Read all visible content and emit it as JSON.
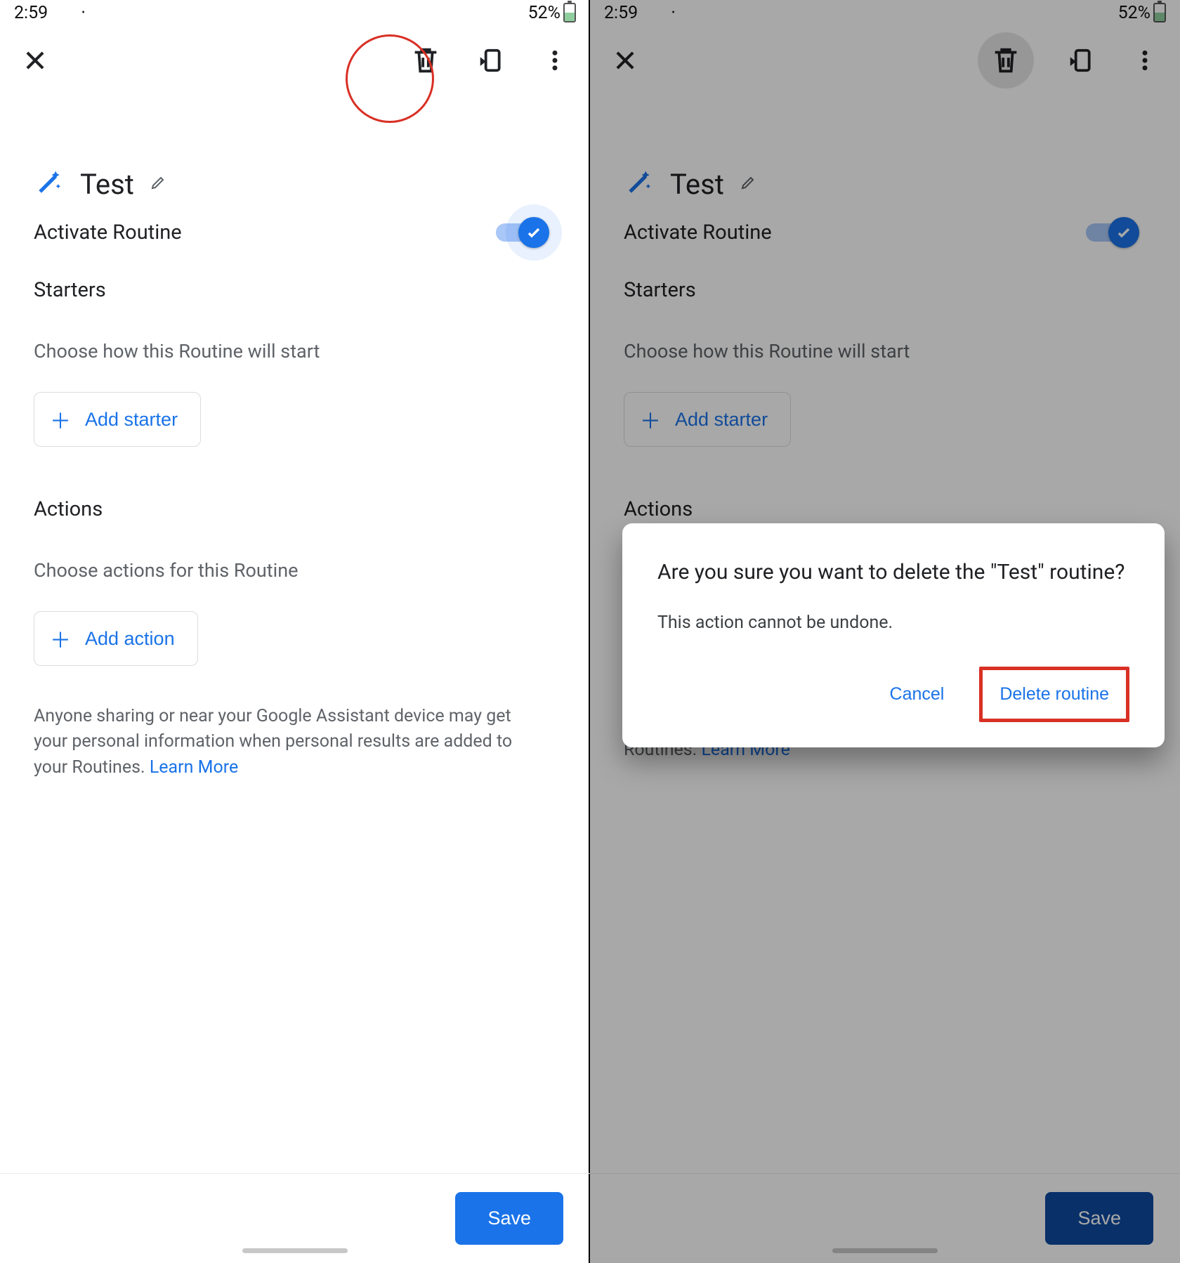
{
  "status": {
    "time": "2:59",
    "batt_pct": "52%"
  },
  "toolbar": {},
  "routine": {
    "name": "Test",
    "activate_label": "Activate Routine",
    "starters_heading": "Starters",
    "starters_sub": "Choose how this Routine will start",
    "add_starter_label": "Add starter",
    "actions_heading": "Actions",
    "actions_sub": "Choose actions for this Routine",
    "add_action_label": "Add action",
    "disclaimer_text": "Anyone sharing or near your Google Assistant device may get your personal information when personal results are added to your Routines. ",
    "learn_more": "Learn More",
    "save_label": "Save"
  },
  "dialog": {
    "title": "Are you sure you want to delete the \"Test\" routine?",
    "body": "This action cannot be undone.",
    "cancel": "Cancel",
    "confirm": "Delete routine"
  }
}
